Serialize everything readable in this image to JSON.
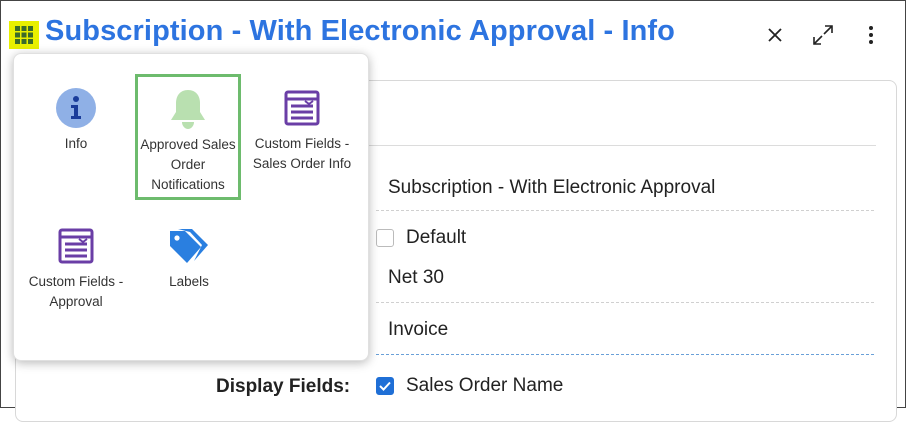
{
  "header": {
    "title": "Subscription - With Electronic Approval - Info",
    "accent_color": "#2d74e0",
    "menu_icon": "grid-icon",
    "close_icon": "close-icon",
    "expand_icon": "expand-icon",
    "more_icon": "more-vertical-icon"
  },
  "form": {
    "name_value": "Subscription - With Electronic Approval",
    "default_label": "Default",
    "default_checked": false,
    "terms_value": "Net 30",
    "type_value": "Invoice",
    "display_fields_label": "Display Fields:",
    "sales_order_name_label": "Sales Order Name",
    "sales_order_name_checked": true
  },
  "popup": {
    "tiles": [
      {
        "label": "Info",
        "icon": "info-icon"
      },
      {
        "label": "Approved Sales Order Notifications",
        "icon": "bell-icon",
        "selected": true
      },
      {
        "label": "Custom Fields - Sales Order Info",
        "icon": "form-icon"
      },
      {
        "label": "Custom Fields - Approval",
        "icon": "form-icon"
      },
      {
        "label": "Labels",
        "icon": "tags-icon"
      }
    ]
  }
}
